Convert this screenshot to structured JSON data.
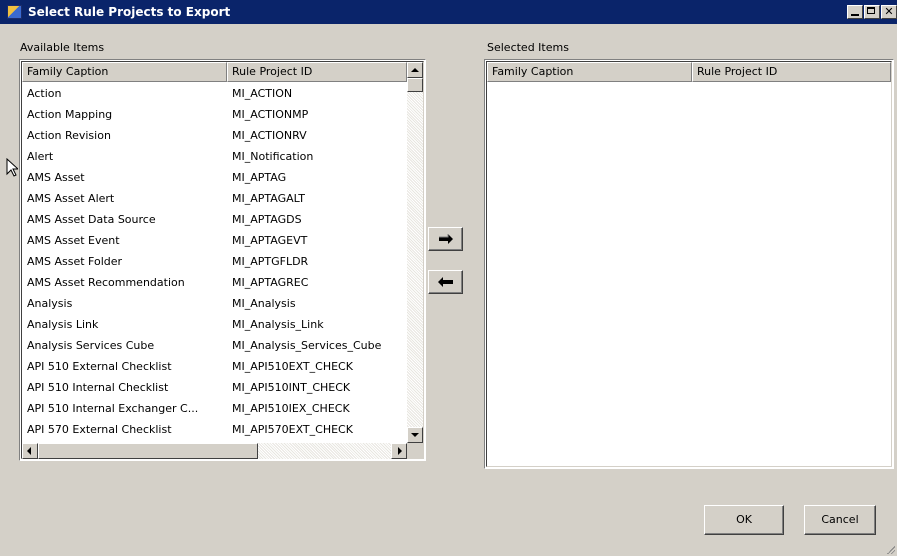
{
  "window": {
    "title": "Select Rule Projects to Export",
    "icon": "app-icon",
    "controls": [
      "minimize-icon",
      "maximize-icon",
      "close-icon"
    ]
  },
  "available": {
    "label": "Available Items",
    "columns": [
      "Family Caption",
      "Rule Project ID"
    ],
    "rows": [
      {
        "caption": "Action",
        "id": "MI_ACTION"
      },
      {
        "caption": "Action Mapping",
        "id": "MI_ACTIONMP"
      },
      {
        "caption": "Action Revision",
        "id": "MI_ACTIONRV"
      },
      {
        "caption": "Alert",
        "id": "MI_Notification"
      },
      {
        "caption": "AMS Asset",
        "id": "MI_APTAG"
      },
      {
        "caption": "AMS Asset Alert",
        "id": "MI_APTAGALT"
      },
      {
        "caption": "AMS Asset Data Source",
        "id": "MI_APTAGDS"
      },
      {
        "caption": "AMS Asset Event",
        "id": "MI_APTAGEVT"
      },
      {
        "caption": "AMS Asset Folder",
        "id": "MI_APTGFLDR"
      },
      {
        "caption": "AMS Asset Recommendation",
        "id": "MI_APTAGREC"
      },
      {
        "caption": "Analysis",
        "id": "MI_Analysis"
      },
      {
        "caption": "Analysis Link",
        "id": "MI_Analysis_Link"
      },
      {
        "caption": "Analysis Services Cube",
        "id": "MI_Analysis_Services_Cube"
      },
      {
        "caption": "API 510 External Checklist",
        "id": "MI_API510EXT_CHECK"
      },
      {
        "caption": "API 510 Internal Checklist",
        "id": "MI_API510INT_CHECK"
      },
      {
        "caption": "API 510 Internal Exchanger C...",
        "id": "MI_API510IEX_CHECK"
      },
      {
        "caption": "API 570 External Checklist",
        "id": "MI_API570EXT_CHECK"
      }
    ]
  },
  "selected": {
    "label": "Selected Items",
    "columns": [
      "Family Caption",
      "Rule Project ID"
    ],
    "rows": []
  },
  "buttons": {
    "add_icon": "arrow-right-icon",
    "remove_icon": "arrow-left-icon",
    "ok": "OK",
    "cancel": "Cancel"
  }
}
